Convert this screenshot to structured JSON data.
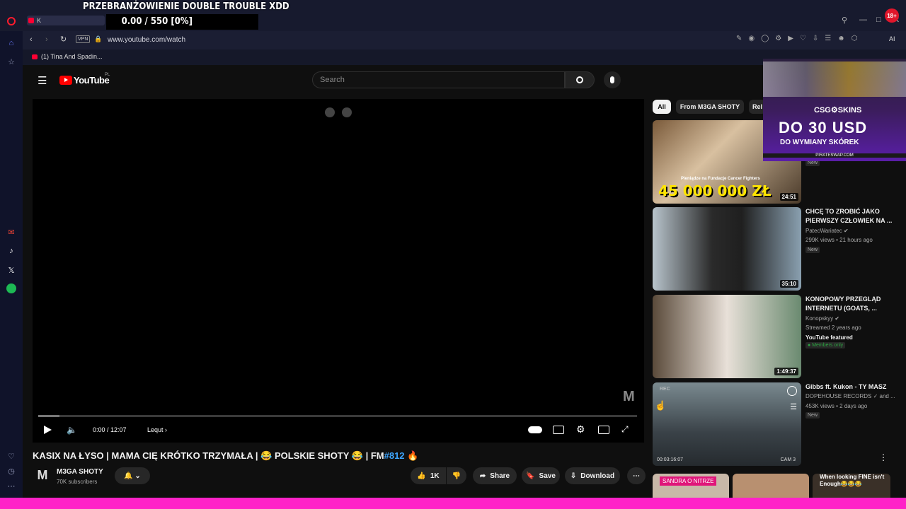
{
  "overlay": {
    "title": "PRZEBRANŻOWIENIE DOUBLE TROUBLE XDD",
    "donation": "0.00 / 550 [0%]"
  },
  "browser": {
    "tab_label": "K",
    "url": "www.youtube.com/watch",
    "vpn_label": "VPN",
    "bookmark": "(1) Tina And Spadin...",
    "ai_label": "AI",
    "notif_count": "18+"
  },
  "youtube": {
    "logo": "YouTube",
    "region": "PL",
    "search_placeholder": "Search",
    "player": {
      "time": "0:00 / 12:07",
      "chapter": "Lequt",
      "watermark": "M"
    },
    "video": {
      "title": "KASIX NA ŁYSO | MAMA CIĘ KRÓTKO TRZYMAŁA | 😂 POLSKIE SHOTY 😂 | FM",
      "hashtag": "#812",
      "emoji_end": "🔥",
      "channel": "M3GA SHOTY",
      "subscribers": "70K subscribers",
      "likes": "1K",
      "share": "Share",
      "save": "Save",
      "download": "Download"
    },
    "chips": [
      "All",
      "From M3GA SHOTY",
      "Rel"
    ],
    "recommendations": [
      {
        "thumb_text": "45 000 000 ZŁ",
        "thumb_sub": "Pieniądze na Fundacje Cancer Fighters",
        "duration": "24:51",
        "badge": "New"
      },
      {
        "title": "CHCĘ TO ZROBIĆ JAKO PIERWSZY CZŁOWIEK NA ...",
        "channel": "PatecWariatec",
        "meta": "299K views • 21 hours ago",
        "badge": "New",
        "duration": "35:10"
      },
      {
        "title": "KONOPOWY PRZEGLĄD INTERNETU (GOATS, ...",
        "channel": "Konopskyy",
        "meta": "Streamed 2 years ago",
        "featured": "YouTube featured",
        "members": "Members only",
        "duration": "1:49:37"
      },
      {
        "title": "Gibbs ft. Kukon - TY MASZ",
        "channel": "DOPEHOUSE RECORDS ✓ and ...",
        "meta": "453K views • 2 days ago",
        "badge": "New",
        "rec_label": "REC",
        "timecode": "00:03:16:07",
        "cam": "CAM 3"
      }
    ],
    "bottom_thumbs": [
      "SANDRA O NITRZE",
      "",
      "When looking FINE isn't Enough😂😂😂"
    ]
  },
  "ad": {
    "brand": "CSG⚙SKINS",
    "headline": "DO 30 USD",
    "sub": "DO WYMIANY SKÓREK",
    "site": "PIRATESWAP.COM"
  }
}
